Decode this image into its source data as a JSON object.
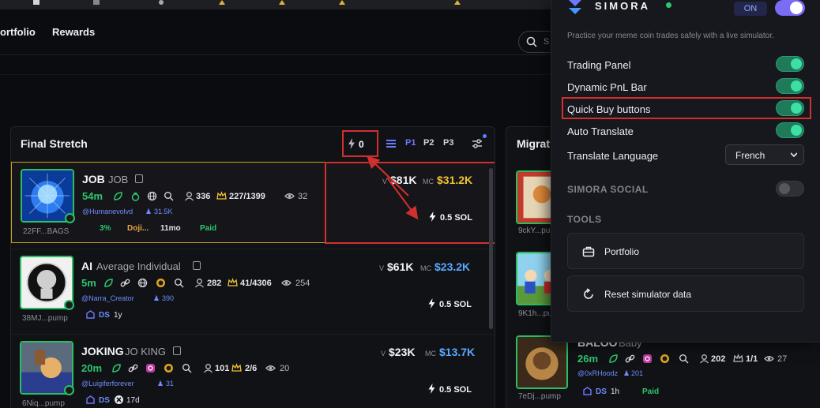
{
  "nav": {
    "portfolio_label": "ortfolio",
    "rewards_label": "Rewards",
    "search_placeholder": "S"
  },
  "panel": {
    "title": "Final Stretch",
    "quick_buy_value": "0",
    "presets": [
      "P1",
      "P2",
      "P3"
    ],
    "active_preset": "P1"
  },
  "tokens": [
    {
      "ticker": "JOB",
      "name": "JOB",
      "age": "54m",
      "holders": "336",
      "top10": "227/1399",
      "views": "32",
      "handle": "@Humanevolvd",
      "followers": "31.5K",
      "address": "22FF...BAGS",
      "tag1": "3%",
      "tag2": "Doji...",
      "tag3": "11mo",
      "tag4": "Paid",
      "volume": "$81K",
      "mcap": "$31.2K",
      "buy": "0.5 SOL",
      "mc_color": "#f1c232"
    },
    {
      "ticker": "AI",
      "name": "Average Individual",
      "age": "5m",
      "holders": "282",
      "top10": "41/4306",
      "views": "254",
      "handle": "@Narra_Creator",
      "followers": "390",
      "address": "38MJ...pump",
      "tag1": "DS",
      "tag2": "1y",
      "volume": "$61K",
      "mcap": "$23.2K",
      "buy": "0.5 SOL",
      "mc_color": "#5aa9ff"
    },
    {
      "ticker": "JOKING",
      "name": "JO KING",
      "age": "20m",
      "holders": "101",
      "top10": "2/6",
      "views": "20",
      "handle": "@Luigiferforever",
      "followers": "31",
      "address": "6Niq...pump",
      "tag1": "DS",
      "tag2": "17d",
      "volume": "$23K",
      "mcap": "$13.7K",
      "buy": "0.5 SOL",
      "mc_color": "#5aa9ff"
    }
  ],
  "labels": {
    "v": "V",
    "mc": "MC"
  },
  "panel2": {
    "title": "Migrat",
    "rows": [
      {
        "address": "9ckY...pump"
      },
      {
        "address": "9K1h...pump"
      },
      {
        "address": "7eDj...pump",
        "ticker": "BALOO",
        "name": "Baby",
        "age": "26m",
        "handle": "@0xRHoodz",
        "followers": "201",
        "holders": "202",
        "top10": "1/1",
        "views": "27",
        "tag1": "DS",
        "tag2": "1h",
        "tag3": "Paid"
      }
    ]
  },
  "extension": {
    "brand": "SIMORA",
    "on_label": "ON",
    "description": "Practice your meme coin trades safely with a live simulator.",
    "options": [
      {
        "label": "Trading Panel",
        "on": true
      },
      {
        "label": "Dynamic PnL Bar",
        "on": true
      },
      {
        "label": "Quick Buy buttons",
        "on": true
      },
      {
        "label": "Auto Translate",
        "on": true
      }
    ],
    "translate_label": "Translate Language",
    "language": "French",
    "social_label": "SIMORA SOCIAL",
    "social_on": false,
    "tools_label": "TOOLS",
    "tools": [
      "Portfolio",
      "Reset simulator data"
    ]
  }
}
